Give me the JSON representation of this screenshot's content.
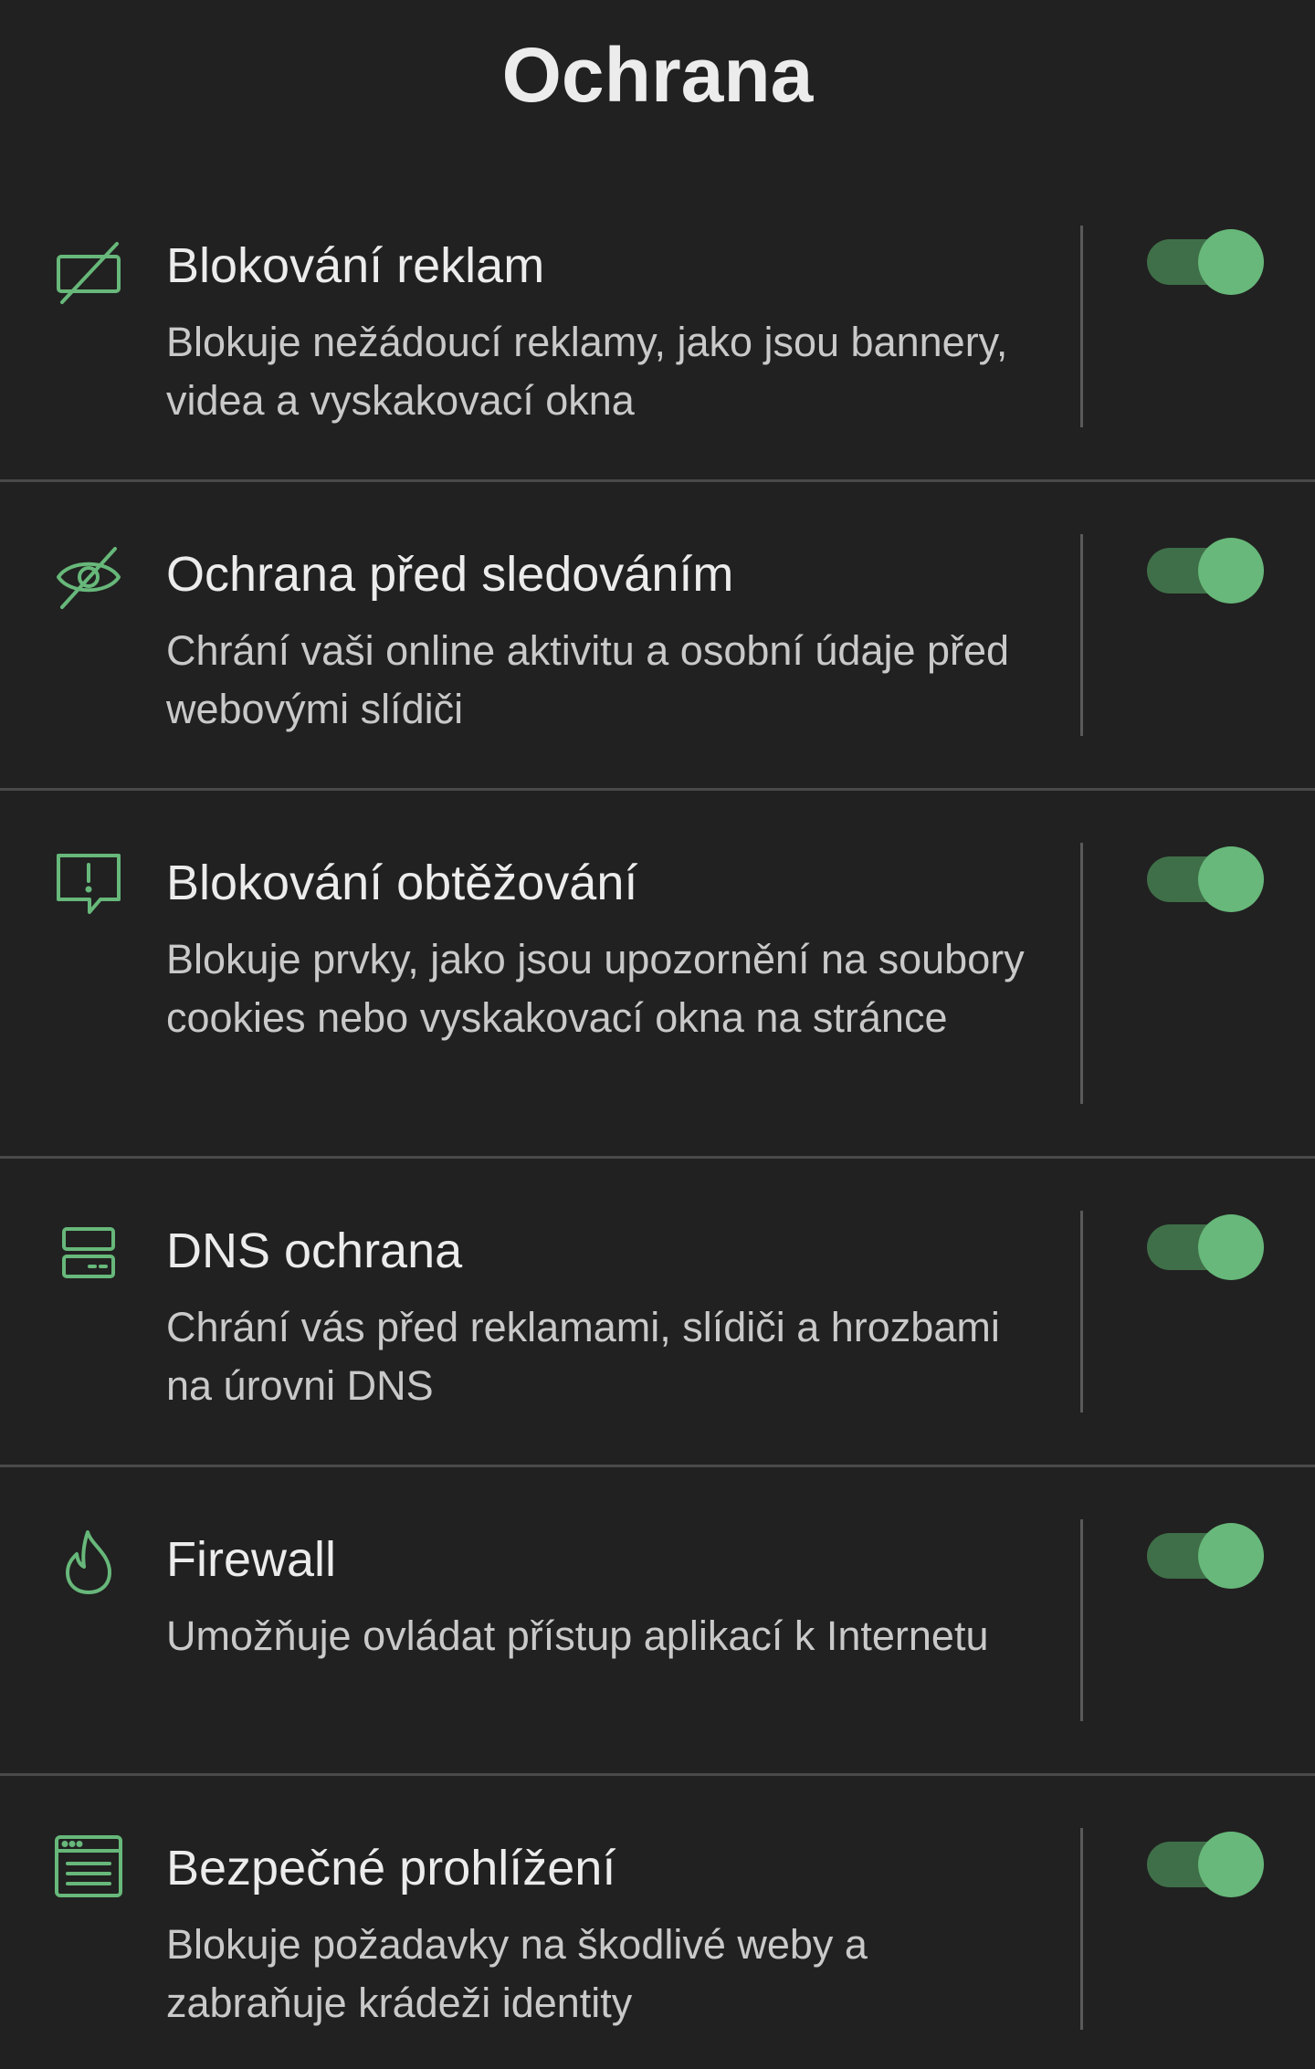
{
  "header": {
    "title": "Ochrana"
  },
  "colors": {
    "background": "#212121",
    "accent": "#67b87a",
    "track": "#3f6f48"
  },
  "items": [
    {
      "icon": "ad-block-icon",
      "title": "Blokování reklam",
      "description": "Blokuje nežádoucí reklamy, jako jsou bannery, videa a vyskakovací okna",
      "enabled": true
    },
    {
      "icon": "eye-off-icon",
      "title": "Ochrana před sledováním",
      "description": "Chrání vaši online aktivitu a osobní údaje před webovými slídiči",
      "enabled": true
    },
    {
      "icon": "alert-message-icon",
      "title": "Blokování obtěžování",
      "description": "Blokuje prvky, jako jsou upozornění na soubory cookies nebo vyskakovací okna na stránce",
      "enabled": true
    },
    {
      "icon": "dns-server-icon",
      "title": "DNS ochrana",
      "description": "Chrání vás před reklamami, slídiči a hrozbami na úrovni DNS",
      "enabled": true
    },
    {
      "icon": "flame-icon",
      "title": "Firewall",
      "description": "Umožňuje ovládat přístup aplikací k Internetu",
      "enabled": true
    },
    {
      "icon": "browser-window-icon",
      "title": "Bezpečné prohlížení",
      "description": "Blokuje požadavky na škodlivé weby a zabraňuje krádeži identity",
      "enabled": true
    }
  ]
}
